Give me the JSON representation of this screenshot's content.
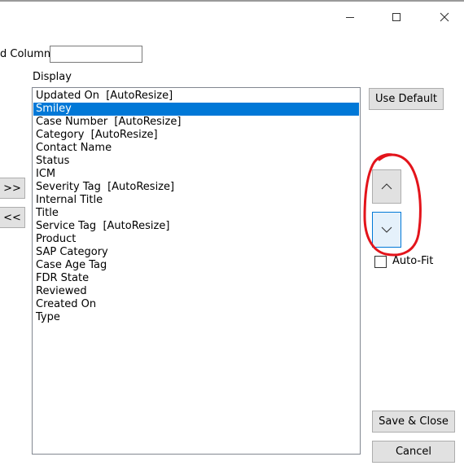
{
  "window": {
    "controls": [
      "minimize-icon",
      "maximize-icon",
      "close-icon"
    ]
  },
  "add_column": {
    "label": "d Column",
    "value": ""
  },
  "display": {
    "label": "Display",
    "items": [
      {
        "text": "Updated On  [AutoResize]",
        "selected": false
      },
      {
        "text": "Smiley",
        "selected": true
      },
      {
        "text": "Case Number  [AutoResize]",
        "selected": false
      },
      {
        "text": "Category  [AutoResize]",
        "selected": false
      },
      {
        "text": "Contact Name",
        "selected": false
      },
      {
        "text": "Status",
        "selected": false
      },
      {
        "text": "ICM",
        "selected": false
      },
      {
        "text": "Severity Tag  [AutoResize]",
        "selected": false
      },
      {
        "text": "Internal Title",
        "selected": false
      },
      {
        "text": "Title",
        "selected": false
      },
      {
        "text": "Service Tag  [AutoResize]",
        "selected": false
      },
      {
        "text": "Product",
        "selected": false
      },
      {
        "text": "SAP Category",
        "selected": false
      },
      {
        "text": "Case Age Tag",
        "selected": false
      },
      {
        "text": "FDR State",
        "selected": false
      },
      {
        "text": "Reviewed",
        "selected": false
      },
      {
        "text": "Created On",
        "selected": false
      },
      {
        "text": "Type",
        "selected": false
      }
    ]
  },
  "buttons": {
    "use_default": "Use Default",
    "move_right": ">>",
    "move_left": "<<",
    "save_close": "Save & Close",
    "cancel": "Cancel"
  },
  "autofit": {
    "label": "Auto-Fit",
    "checked": false
  },
  "colors": {
    "selection": "#0078d7",
    "annotation": "#e3141b"
  }
}
